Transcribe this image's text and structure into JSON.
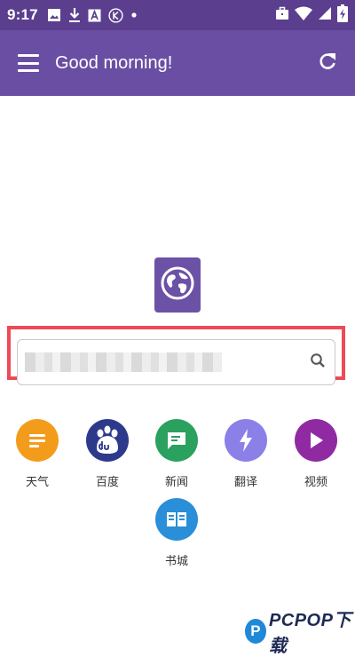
{
  "status_bar": {
    "time": "9:17",
    "notification_icons": [
      "gallery-icon",
      "download-icon",
      "a-badge-icon",
      "k-circle-icon",
      "dot-icon"
    ],
    "status_icons": [
      "briefcase-icon",
      "wifi-icon",
      "signal-icon",
      "battery-charging-icon"
    ]
  },
  "app_bar": {
    "greeting": "Good morning!",
    "menu_icon": "menu-icon",
    "refresh_icon": "refresh-icon"
  },
  "logo": {
    "icon": "globe-icon"
  },
  "search": {
    "value": "",
    "icon": "search-icon"
  },
  "shortcuts": [
    {
      "label": "天气",
      "icon": "weather-lines-icon",
      "color": "#f39c1b"
    },
    {
      "label": "百度",
      "icon": "baidu-paw-icon",
      "color": "#2d3a8c"
    },
    {
      "label": "新闻",
      "icon": "news-message-icon",
      "color": "#2aa15e"
    },
    {
      "label": "翻译",
      "icon": "translate-bolt-icon",
      "color": "#8b7fe8"
    },
    {
      "label": "视频",
      "icon": "video-play-icon",
      "color": "#8f2aa3"
    },
    {
      "label": "书城",
      "icon": "book-icon",
      "color": "#2a8fd8"
    }
  ],
  "colors": {
    "app_bar": "#6a4ea3",
    "status_bar": "#5b3f8e",
    "highlight": "#ef4a57"
  }
}
